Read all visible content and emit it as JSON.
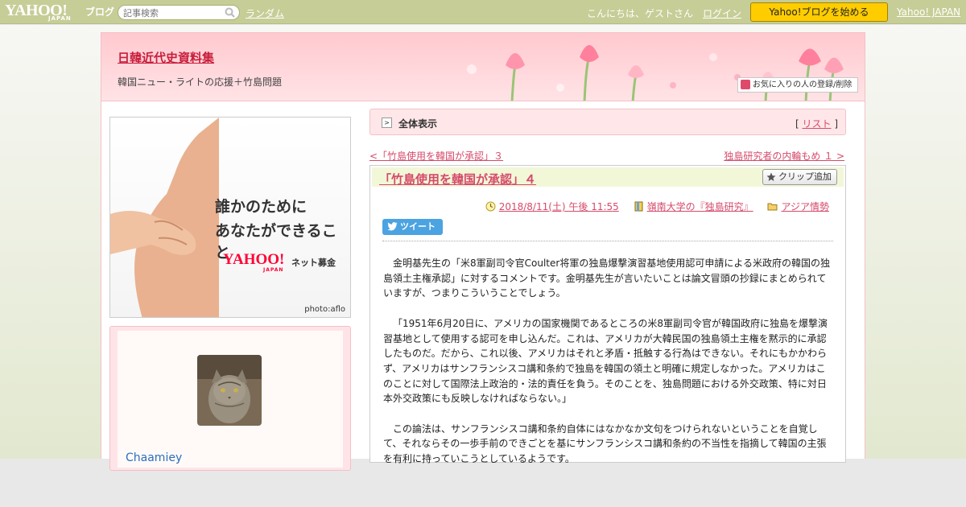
{
  "topbar": {
    "logo_text": "YAHOO!",
    "logo_sub": "JAPAN",
    "logo_blog": "ブログ",
    "search_placeholder": "記事検索",
    "random_link": "ランダム",
    "greeting": "こんにちは、ゲストさん",
    "login_link": "ログイン",
    "start_button": "Yahoo!ブログを始める",
    "yahoo_japan_link": "Yahoo! JAPAN"
  },
  "header": {
    "blog_title": "日韓近代史資料集",
    "blog_description": "韓国ニュー・ライトの応援＋竹島問題",
    "favorite_button": "お気に入りの人の登録/削除"
  },
  "sidebar": {
    "ad": {
      "line1": "誰かのために",
      "line2": "あなたができること",
      "logo": "YAHOO!",
      "logo_sub": "JAPAN",
      "service": "ネット募金",
      "credit": "photo:aflo"
    },
    "profile": {
      "name": "Chaamiey"
    }
  },
  "main": {
    "view_label": "全体表示",
    "list_prefix": "[",
    "list_link": "リスト",
    "list_suffix": "]",
    "prev_link": "<「竹島使用を韓国が承認」３",
    "next_link": "独島研究者の内輪もめ １ >",
    "article": {
      "title": "「竹島使用を韓国が承認」４",
      "clip_button": "クリップ追加",
      "date": "2018/8/11(土) 午後 11:55",
      "book_category": "嶺南大学の『独島研究』",
      "folder_category": "アジア情勢",
      "tweet_button": "ツイート",
      "paragraphs": [
        "金明基先生の「米8軍副司令官Coulter将軍の独島爆撃演習基地使用認可申請による米政府の韓国の独島領土主権承認」に対するコメントです。金明基先生が言いたいことは論文冒頭の抄録にまとめられていますが、つまりこういうことでしょう。",
        "「1951年6月20日に、アメリカの国家機関であるところの米8軍副司令官が韓国政府に独島を爆撃演習基地として使用する認可を申し込んだ。これは、アメリカが大韓民国の独島領土主権を黙示的に承認したものだ。だから、これ以後、アメリカはそれと矛盾・抵触する行為はできない。それにもかかわらず、アメリカはサンフランシスコ講和条約で独島を韓国の領土と明確に規定しなかった。アメリカはこのことに対して国際法上政治的・法的責任を負う。そのことを、独島問題における外交政策、特に対日本外交政策にも反映しなければならない。」",
        "この論法は、サンフランシスコ講和条約自体にはなかなか文句をつけられないということを自覚して、それならその一歩手前のできごとを基にサンフランシスコ講和条約の不当性を指摘して韓国の主張を有利に持っていこうとしているようです。"
      ]
    }
  },
  "colors": {
    "topbar": "#c6cd96",
    "accent_pink": "#d64a6b",
    "start_button": "#ffcc00",
    "tweet_blue": "#4ba3e1"
  }
}
